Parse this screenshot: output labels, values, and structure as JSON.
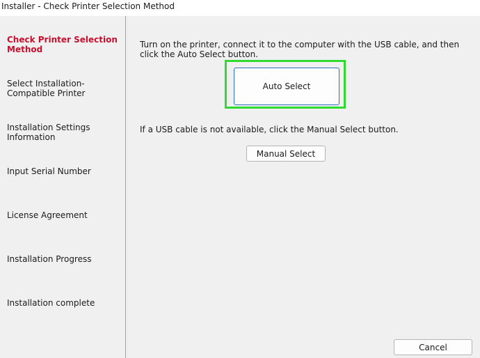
{
  "window": {
    "title": "Installer - Check Printer Selection Method"
  },
  "sidebar": {
    "steps": [
      {
        "label": "Check Printer Selection Method",
        "active": true
      },
      {
        "label": "Select Installation-Compatible Printer",
        "active": false
      },
      {
        "label": "Installation Settings Information",
        "active": false
      },
      {
        "label": "Input Serial Number",
        "active": false
      },
      {
        "label": "License Agreement",
        "active": false
      },
      {
        "label": "Installation Progress",
        "active": false
      },
      {
        "label": "Installation complete",
        "active": false
      }
    ]
  },
  "main": {
    "instruction_auto": "Turn on the printer, connect it to the computer with the USB cable, and then click the Auto Select button.",
    "auto_select_label": "Auto Select",
    "instruction_manual": "If a USB cable is not available, click the Manual Select button.",
    "manual_select_label": "Manual Select"
  },
  "footer": {
    "cancel_label": "Cancel"
  },
  "colors": {
    "active_step": "#c8102e",
    "highlight": "#2edb2e",
    "primary_button_border": "#2a6fc0"
  }
}
